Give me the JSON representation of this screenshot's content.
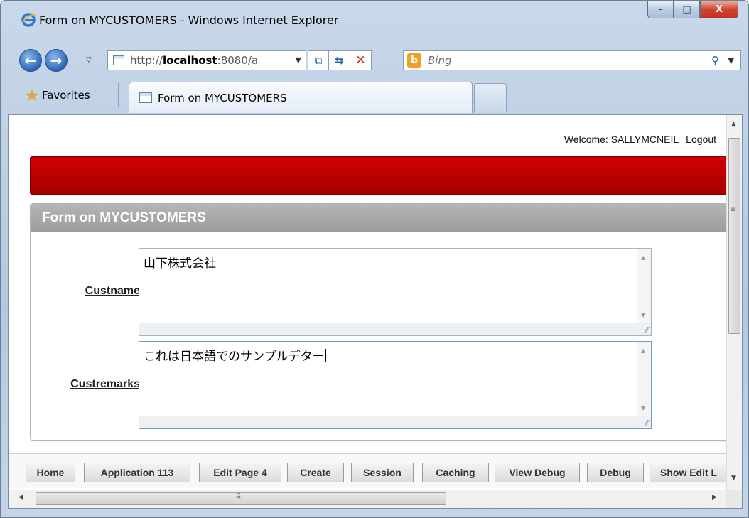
{
  "window": {
    "title": "Form on MYCUSTOMERS - Windows Internet Explorer",
    "controls": {
      "minimize": "–",
      "maximize": "□",
      "close": "X"
    }
  },
  "navbar": {
    "url_prefix": "http://",
    "url_host": "localhost",
    "url_rest": ":8080/a",
    "search_placeholder": "Bing",
    "bing_glyph": "b",
    "back_glyph": "←",
    "forward_glyph": "→"
  },
  "tabs": {
    "favorites_label": "Favorites",
    "active_tab_label": "Form on MYCUSTOMERS"
  },
  "page": {
    "welcome_text": "Welcome: SALLYMCNEIL",
    "logout_label": "Logout",
    "region_title": "Form on MYCUSTOMERS",
    "fields": [
      {
        "label": "Custname",
        "value": "山下株式会社"
      },
      {
        "label": "Custremarks",
        "value": "これは日本語でのサンプルデター"
      }
    ],
    "dev_toolbar": [
      "Home",
      "Application 113",
      "Edit Page 4",
      "Create",
      "Session",
      "Caching",
      "View Debug",
      "Debug",
      "Show Edit L"
    ]
  },
  "scrollbars": {
    "grip_v": "≡",
    "grip_h": "⦙⦙⦙"
  },
  "colors": {
    "banner_red": "#c00000",
    "region_header_gray": "#a8a8a8",
    "chrome_blue": "#b9cde4"
  }
}
